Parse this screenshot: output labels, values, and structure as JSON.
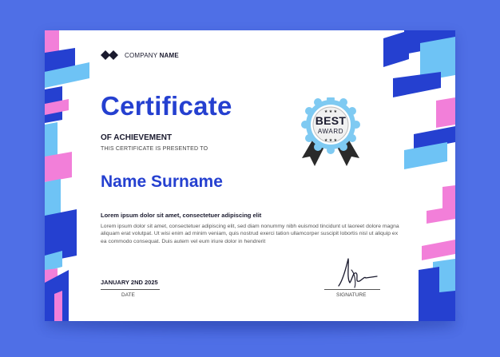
{
  "company": {
    "prefix": "COMPANY",
    "name": "NAME"
  },
  "certificate": {
    "title": "Certificate",
    "subtitle": "OF ACHIEVEMENT",
    "presented_to": "THIS CERTIFICATE IS PRESENTED TO",
    "recipient": "Name Surname",
    "lead": "Lorem ipsum dolor sit amet, consectetuer adipiscing elit",
    "body": "Lorem ipsum dolor sit amet, consectetuer adipiscing elit, sed diam nonummy nibh euismod tincidunt ut laoreet dolore magna aliquam erat volutpat. Ut wisi enim ad minim veniam, quis nostrud exerci tation ullamcorper suscipit lobortis nisl ut aliquip ex ea commodo consequat. Duis autem vel eum iriure dolor in hendrerit"
  },
  "badge": {
    "line1": "BEST",
    "line2": "AWARD"
  },
  "footer": {
    "date_value": "JANUARY 2ND 2025",
    "date_label": "DATE",
    "signature_label": "SIGNATURE"
  },
  "colors": {
    "background": "#4f6fe6",
    "primary_blue": "#2540d0",
    "light_blue": "#6ec3f5",
    "pink": "#f27fd9"
  }
}
